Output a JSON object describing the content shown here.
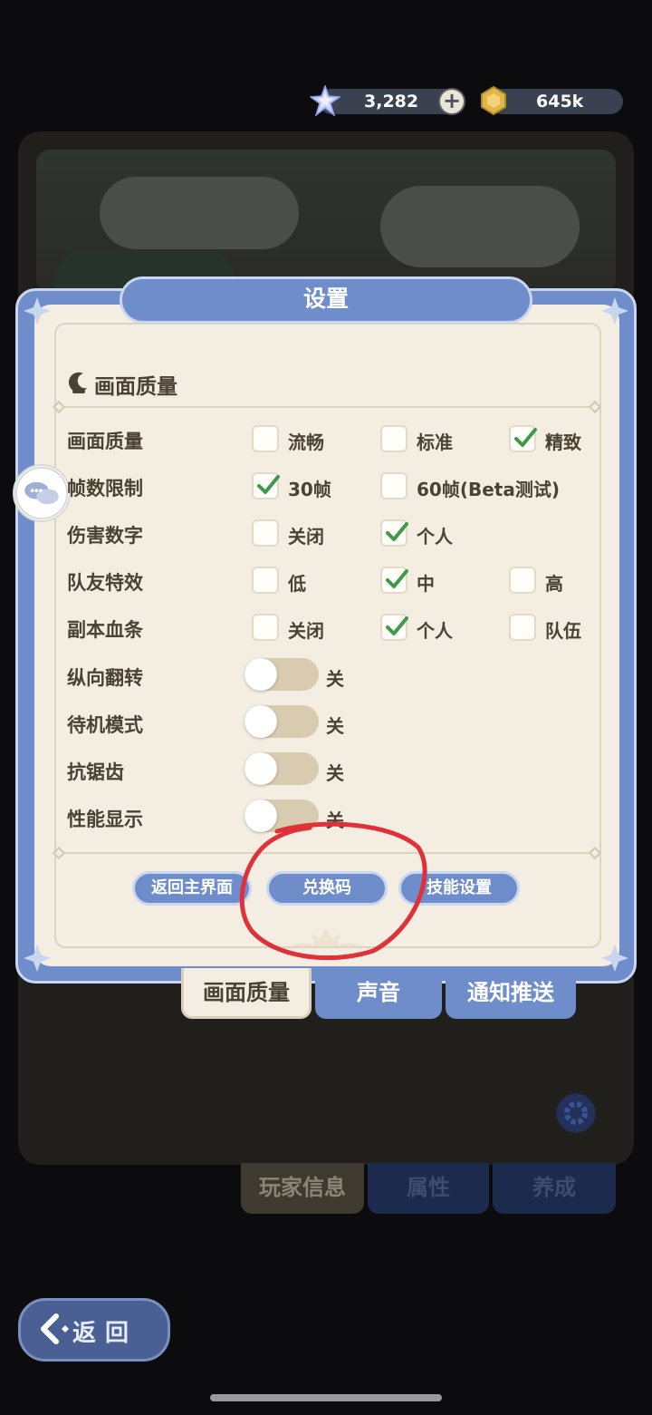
{
  "currency": {
    "gems": "3,282",
    "gold": "645k",
    "add_label": "+"
  },
  "dialog": {
    "title": "设置",
    "section_title": "画面质量",
    "rows": [
      {
        "label": "画面质量",
        "options": [
          {
            "text": "流畅",
            "checked": false
          },
          {
            "text": "标准",
            "checked": false
          },
          {
            "text": "精致",
            "checked": true
          }
        ]
      },
      {
        "label": "帧数限制",
        "options": [
          {
            "text": "30帧",
            "checked": true
          },
          {
            "text": "60帧(Beta测试)",
            "checked": false
          }
        ]
      },
      {
        "label": "伤害数字",
        "options": [
          {
            "text": "关闭",
            "checked": false
          },
          {
            "text": "个人",
            "checked": true
          }
        ]
      },
      {
        "label": "队友特效",
        "options": [
          {
            "text": "低",
            "checked": false
          },
          {
            "text": "中",
            "checked": true
          },
          {
            "text": "高",
            "checked": false
          }
        ]
      },
      {
        "label": "副本血条",
        "options": [
          {
            "text": "关闭",
            "checked": false
          },
          {
            "text": "个人",
            "checked": true
          },
          {
            "text": "队伍",
            "checked": false
          }
        ]
      }
    ],
    "toggles": [
      {
        "label": "纵向翻转",
        "state": "关"
      },
      {
        "label": "待机模式",
        "state": "关"
      },
      {
        "label": "抗锯齿",
        "state": "关"
      },
      {
        "label": "性能显示",
        "state": "关"
      }
    ],
    "buttons": {
      "home": "返回主界面",
      "redeem": "兑换码",
      "skills": "技能设置"
    },
    "tabs": [
      "画面质量",
      "声音",
      "通知推送"
    ]
  },
  "background": {
    "tabs": [
      "玩家信息",
      "属性",
      "养成"
    ]
  },
  "back_button": "返回",
  "colors": {
    "dialog_blue": "#6f8ccb",
    "parchment": "#f4eee2",
    "check_green": "#3d9a4a",
    "annotation_red": "#e0303a"
  }
}
